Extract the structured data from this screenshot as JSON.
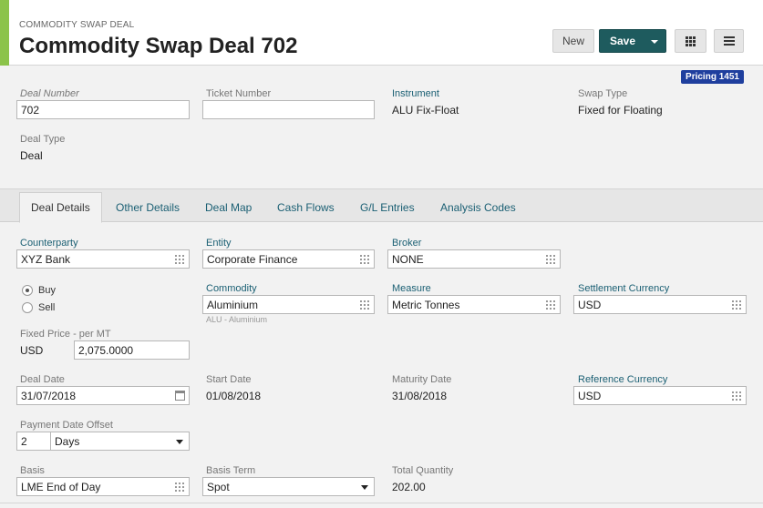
{
  "header": {
    "eyebrow": "COMMODITY SWAP DEAL",
    "title": "Commodity Swap Deal 702",
    "new_label": "New",
    "save_label": "Save",
    "badge": "Pricing 1451"
  },
  "summary": {
    "deal_number_label": "Deal Number",
    "deal_number_value": "702",
    "ticket_number_label": "Ticket Number",
    "ticket_number_value": "",
    "instrument_label": "Instrument",
    "instrument_value": "ALU Fix-Float",
    "swap_type_label": "Swap Type",
    "swap_type_value": "Fixed for Floating",
    "deal_type_label": "Deal Type",
    "deal_type_value": "Deal"
  },
  "tabs": [
    {
      "label": "Deal Details"
    },
    {
      "label": "Other Details"
    },
    {
      "label": "Deal Map"
    },
    {
      "label": "Cash Flows"
    },
    {
      "label": "G/L Entries"
    },
    {
      "label": "Analysis Codes"
    }
  ],
  "details": {
    "counterparty_label": "Counterparty",
    "counterparty_value": "XYZ Bank",
    "entity_label": "Entity",
    "entity_value": "Corporate Finance",
    "broker_label": "Broker",
    "broker_value": "NONE",
    "buy_label": "Buy",
    "sell_label": "Sell",
    "commodity_label": "Commodity",
    "commodity_value": "Aluminium",
    "commodity_hint": "ALU - Aluminium",
    "measure_label": "Measure",
    "measure_value": "Metric Tonnes",
    "settlement_currency_label": "Settlement Currency",
    "settlement_currency_value": "USD",
    "fixed_price_label": "Fixed Price - per MT",
    "fixed_price_currency": "USD",
    "fixed_price_value": "2,075.0000",
    "deal_date_label": "Deal Date",
    "deal_date_value": "31/07/2018",
    "start_date_label": "Start Date",
    "start_date_value": "01/08/2018",
    "maturity_date_label": "Maturity Date",
    "maturity_date_value": "31/08/2018",
    "reference_currency_label": "Reference Currency",
    "reference_currency_value": "USD",
    "payment_offset_label": "Payment Date Offset",
    "payment_offset_value": "2",
    "payment_offset_unit": "Days",
    "basis_label": "Basis",
    "basis_value": "LME End of Day",
    "basis_term_label": "Basis Term",
    "basis_term_value": "Spot",
    "total_quantity_label": "Total Quantity",
    "total_quantity_value": "202.00"
  }
}
